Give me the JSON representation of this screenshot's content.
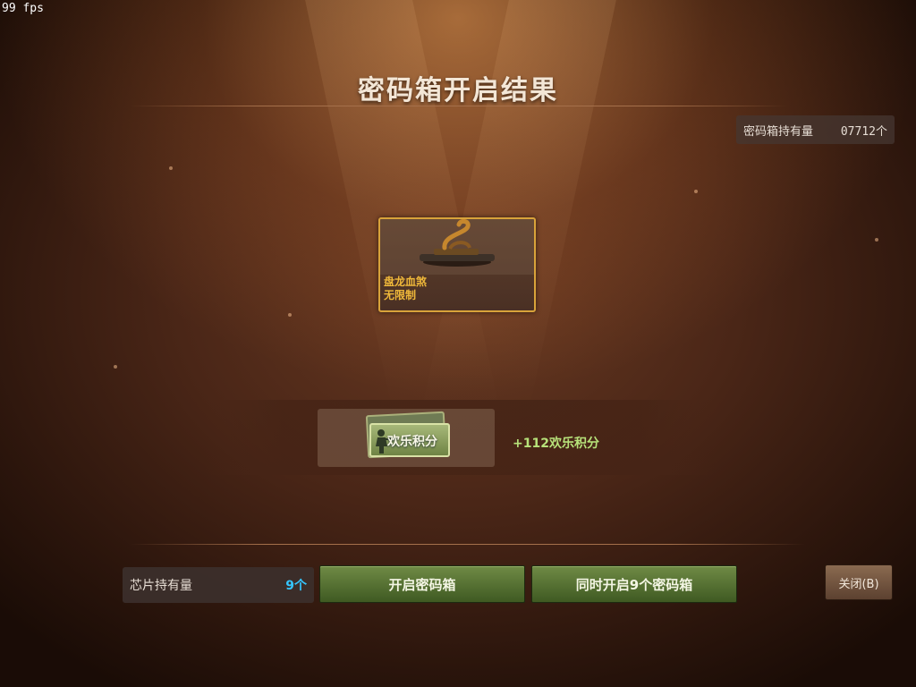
{
  "hud": {
    "fps": "99 fps"
  },
  "title": "密码箱开启结果",
  "owned_boxes": {
    "label": "密码箱持有量",
    "value": "07712个"
  },
  "result_item": {
    "name": "盘龙血煞",
    "duration": "无限制",
    "icon": "coiled-dragon-weapon-icon"
  },
  "reward": {
    "card_label": "欢乐积分",
    "amount": "+112欢乐积分",
    "icon": "soldier-card-icon"
  },
  "chips": {
    "label": "芯片持有量",
    "value": "9个"
  },
  "buttons": {
    "open": "开启密码箱",
    "open_multi": "同时开启9个密码箱",
    "close": "关闭(B)"
  },
  "colors": {
    "accent_gold": "#d9a33a",
    "reward_green": "#b7e27a",
    "chip_blue": "#35c6ff"
  }
}
